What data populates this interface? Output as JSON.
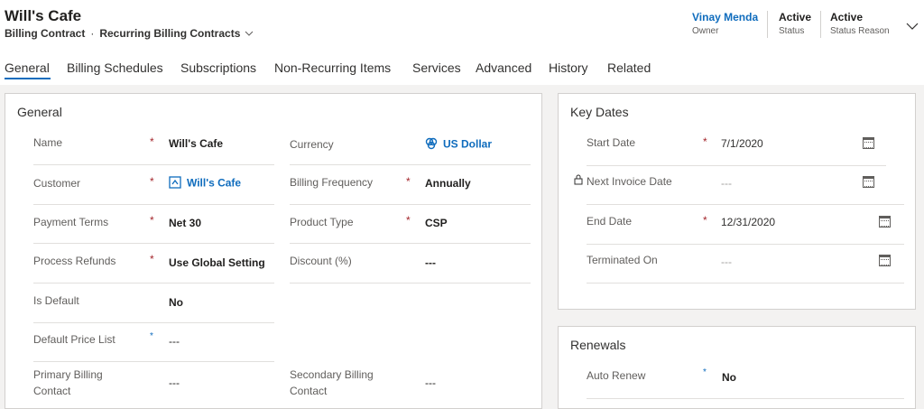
{
  "header": {
    "title": "Will's Cafe",
    "entity": "Billing Contract",
    "separator": "·",
    "view": "Recurring Billing Contracts",
    "chevron": "⌵",
    "fields": [
      {
        "value": "Vinay Menda",
        "label": "Owner"
      },
      {
        "value": "Active",
        "label": "Status"
      },
      {
        "value": "Active",
        "label": "Status Reason"
      }
    ],
    "expand_icon": "chevron-down-icon"
  },
  "tabs": [
    "General",
    "Billing Schedules",
    "Subscriptions",
    "Non-Recurring Items",
    "Services",
    "Advanced",
    "History",
    "Related"
  ],
  "general": {
    "title": "General",
    "fields": {
      "name": {
        "label": "Name",
        "value": "Will's Cafe"
      },
      "currency": {
        "label": "Currency",
        "value": "US Dollar"
      },
      "customer": {
        "label": "Customer",
        "value": "Will's Cafe"
      },
      "billing_frequency": {
        "label": "Billing Frequency",
        "value": "Annually"
      },
      "payment_terms": {
        "label": "Payment Terms",
        "value": "Net 30"
      },
      "product_type": {
        "label": "Product Type",
        "value": "CSP"
      },
      "process_refunds": {
        "label": "Process Refunds",
        "value": "Use Global Setting"
      },
      "discount": {
        "label": "Discount (%)",
        "value": "---"
      },
      "is_default": {
        "label": "Is Default",
        "value": "No"
      },
      "default_price_list": {
        "label": "Default Price List",
        "value": "---"
      },
      "primary_billing_contact": {
        "label_1": "Primary Billing",
        "label_2": "Contact",
        "value": "---"
      },
      "secondary_billing_contact": {
        "label_1": "Secondary Billing",
        "label_2": "Contact",
        "value": "---"
      }
    },
    "required_mark": "*"
  },
  "key_dates": {
    "title": "Key Dates",
    "fields": {
      "start_date": {
        "label": "Start Date",
        "value": "7/1/2020"
      },
      "next_invoice_date": {
        "label": "Next Invoice Date",
        "value": "---"
      },
      "end_date": {
        "label": "End Date",
        "value": "12/31/2020"
      },
      "terminated_on": {
        "label": "Terminated On",
        "value": "---"
      }
    }
  },
  "renewals": {
    "title": "Renewals",
    "fields": {
      "auto_renew": {
        "label": "Auto Renew",
        "value": "No"
      }
    }
  },
  "colors": {
    "accent": "#0f6cbd",
    "required": "#a4262c"
  }
}
